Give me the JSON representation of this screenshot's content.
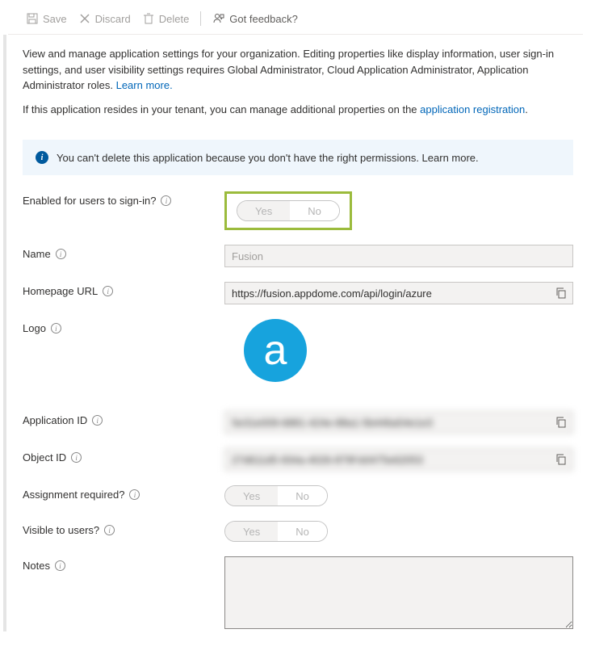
{
  "toolbar": {
    "save": "Save",
    "discard": "Discard",
    "delete": "Delete",
    "feedback": "Got feedback?"
  },
  "intro": {
    "text1": "View and manage application settings for your organization. Editing properties like display information, user sign-in settings, and user visibility settings requires Global Administrator, Cloud Application Administrator, Application Administrator roles. ",
    "learn_more": "Learn more.",
    "text2a": "If this application resides in your tenant, you can manage additional properties on the ",
    "app_reg_link": "application registration",
    "text2b": "."
  },
  "infobar": "You can't delete this application because you don't have the right permissions. Learn more.",
  "labels": {
    "enabled": "Enabled for users to sign-in?",
    "name": "Name",
    "homepage": "Homepage URL",
    "logo": "Logo",
    "appid": "Application ID",
    "objectid": "Object ID",
    "assignment": "Assignment required?",
    "visible": "Visible to users?",
    "notes": "Notes"
  },
  "values": {
    "name": "Fusion",
    "homepage": "https://fusion.appdome.com/api/login/azure",
    "appid_mask": "5e31e009-6881-424e-88a1-5b446a54e1e3",
    "objectid_mask": "27d611d5-934a-4026-879f-b0475e62053",
    "logo_letter": "a"
  },
  "toggle": {
    "yes": "Yes",
    "no": "No"
  }
}
